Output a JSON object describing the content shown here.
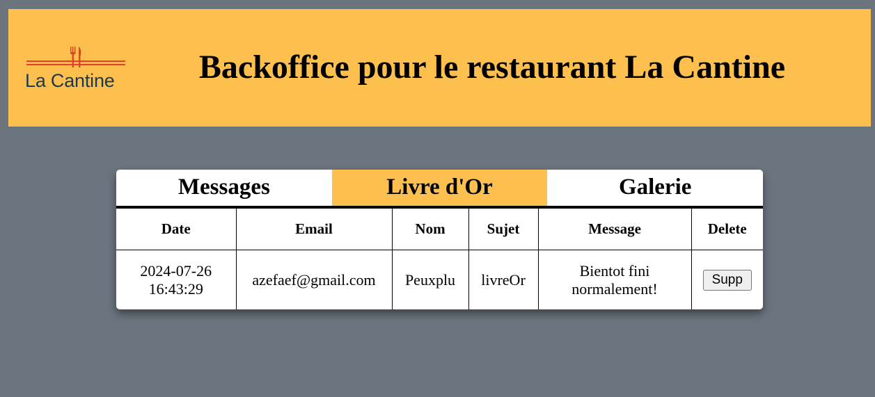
{
  "header": {
    "logo_text": "La Cantine",
    "title": "Backoffice pour le restaurant La Cantine"
  },
  "colors": {
    "page_background": "#6c747e",
    "accent": "#fdbf4d",
    "logo_red": "#e3402d",
    "logo_text": "#1c3a4f"
  },
  "tabs": [
    {
      "label": "Messages",
      "active": false
    },
    {
      "label": "Livre d'Or",
      "active": true
    },
    {
      "label": "Galerie",
      "active": false
    }
  ],
  "table": {
    "columns": [
      "Date",
      "Email",
      "Nom",
      "Sujet",
      "Message",
      "Delete"
    ],
    "rows": [
      {
        "date_line1": "2024-07-26",
        "date_line2": "16:43:29",
        "email": "azefaef@gmail.com",
        "nom": "Peuxplu",
        "sujet": "livreOr",
        "message_line1": "Bientot fini",
        "message_line2": "normalement!",
        "delete_label": "Supp"
      }
    ]
  }
}
